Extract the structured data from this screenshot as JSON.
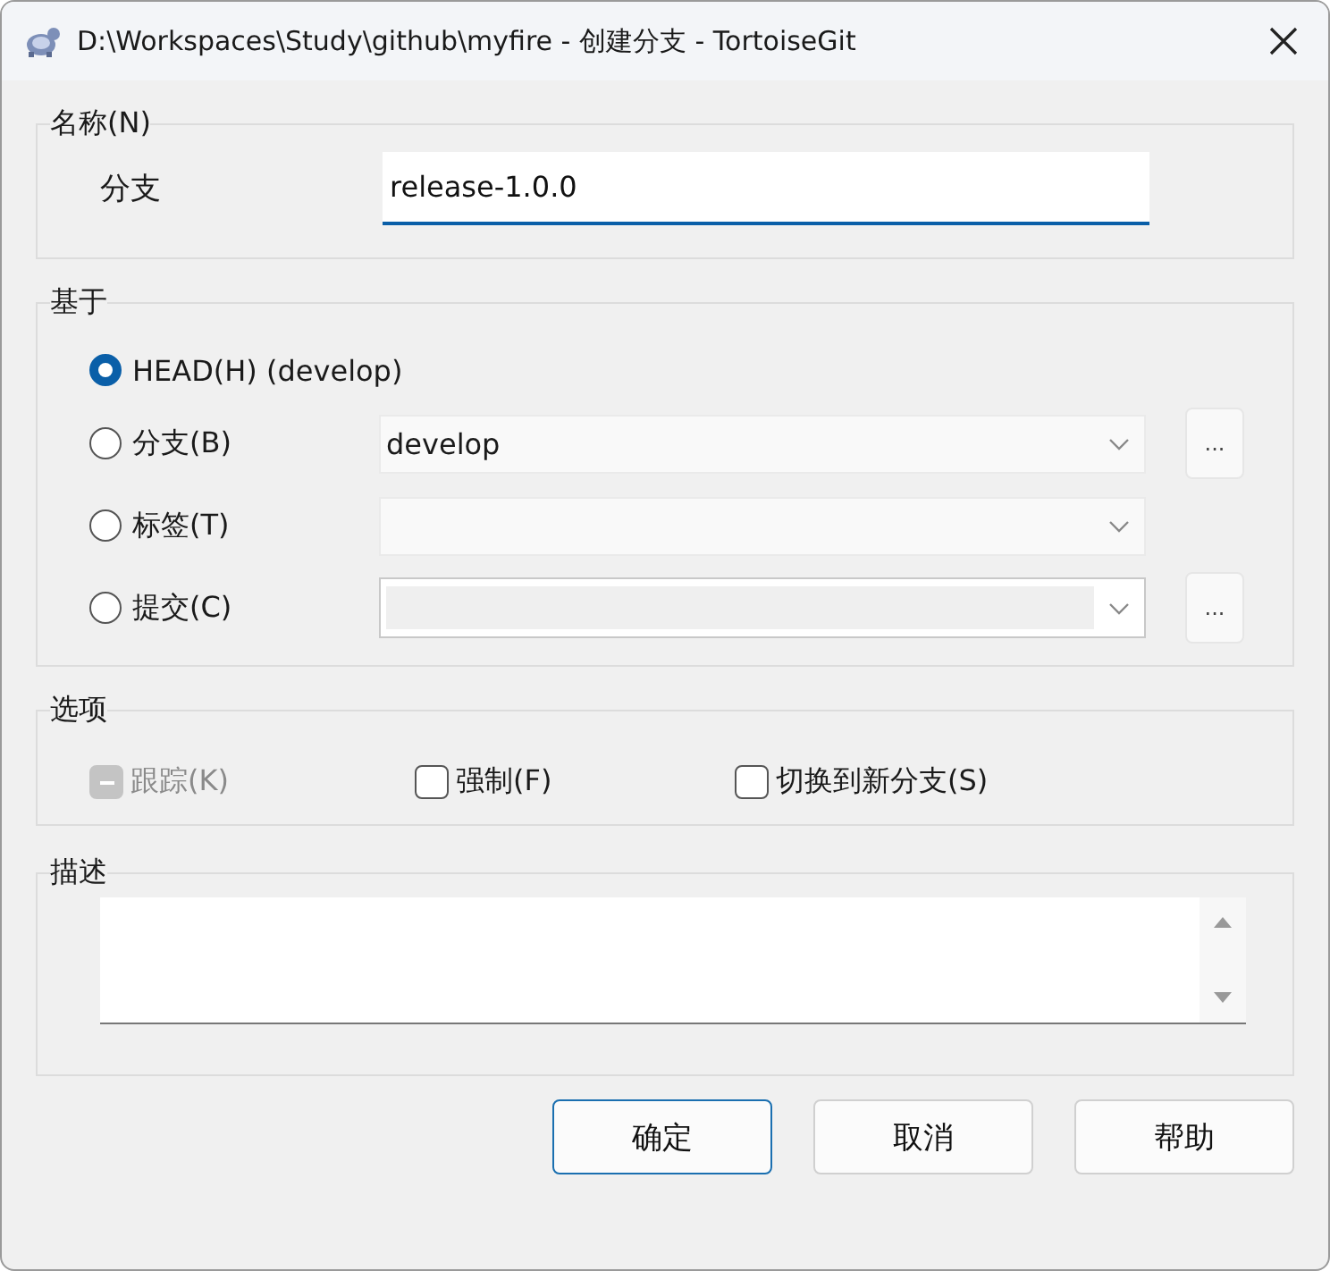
{
  "window": {
    "title": "D:\\Workspaces\\Study\\github\\myfire - 创建分支 - TortoiseGit"
  },
  "name_group": {
    "legend": "名称(N)",
    "label": "分支",
    "value": "release-1.0.0"
  },
  "base_group": {
    "legend": "基于",
    "options": [
      {
        "label": "HEAD(H) (develop)",
        "selected": true,
        "kind": "plain"
      },
      {
        "label": "分支(B)",
        "selected": false,
        "kind": "combo",
        "value": "develop",
        "browse": "..."
      },
      {
        "label": "标签(T)",
        "selected": false,
        "kind": "combo"
      },
      {
        "label": "提交(C)",
        "selected": false,
        "kind": "editcombo",
        "browse": "..."
      }
    ]
  },
  "options_group": {
    "legend": "选项",
    "checkboxes": [
      {
        "label": "跟踪(K)",
        "checked": false,
        "indeterminate": true,
        "disabled": true
      },
      {
        "label": "强制(F)",
        "checked": false,
        "indeterminate": false,
        "disabled": false
      },
      {
        "label": "切换到新分支(S)",
        "checked": false,
        "indeterminate": false,
        "disabled": false
      }
    ]
  },
  "description_group": {
    "legend": "描述"
  },
  "buttons": [
    {
      "label": "确定",
      "default": true
    },
    {
      "label": "取消",
      "default": false
    },
    {
      "label": "帮助",
      "default": false
    }
  ]
}
